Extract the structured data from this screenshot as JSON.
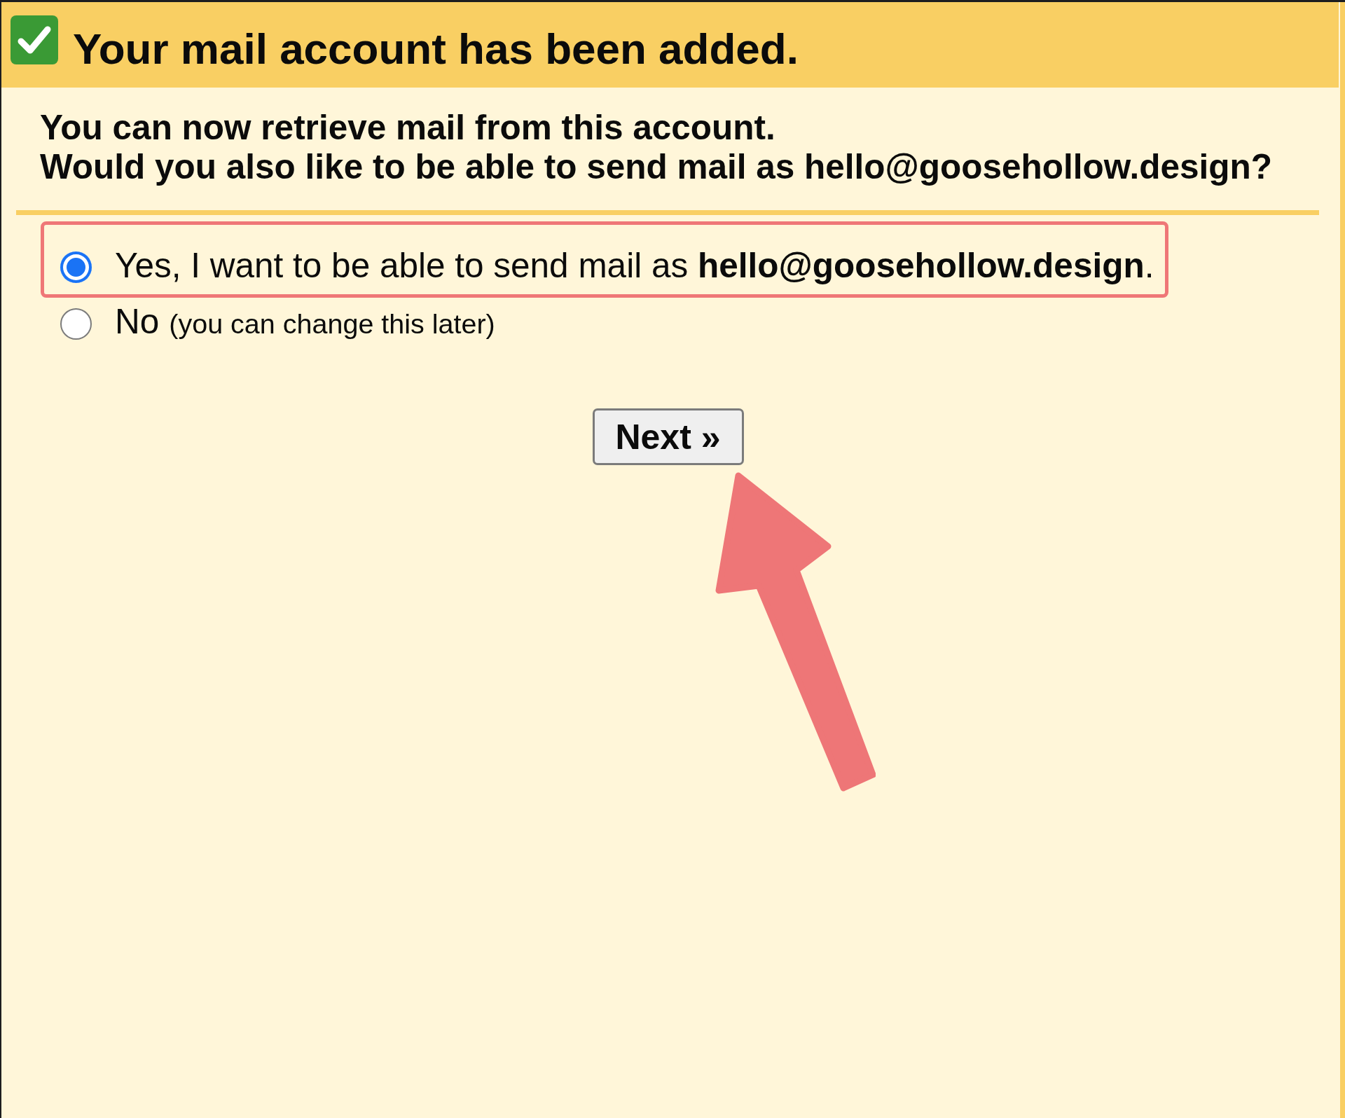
{
  "header": {
    "title": "Your mail account has been added."
  },
  "message": {
    "lines": [
      "You can now retrieve mail from this account.",
      "Would you also like to be able to send mail as hello@goosehollow.design?"
    ]
  },
  "options": [
    {
      "label": "Yes, I want to be able to send mail as **hello@goosehollow.design**.",
      "selected": true,
      "highlighted": true
    },
    {
      "label": "No",
      "note": "(you can change this later)",
      "selected": false,
      "highlighted": false
    }
  ],
  "next_button": {
    "label": "Next »"
  }
}
